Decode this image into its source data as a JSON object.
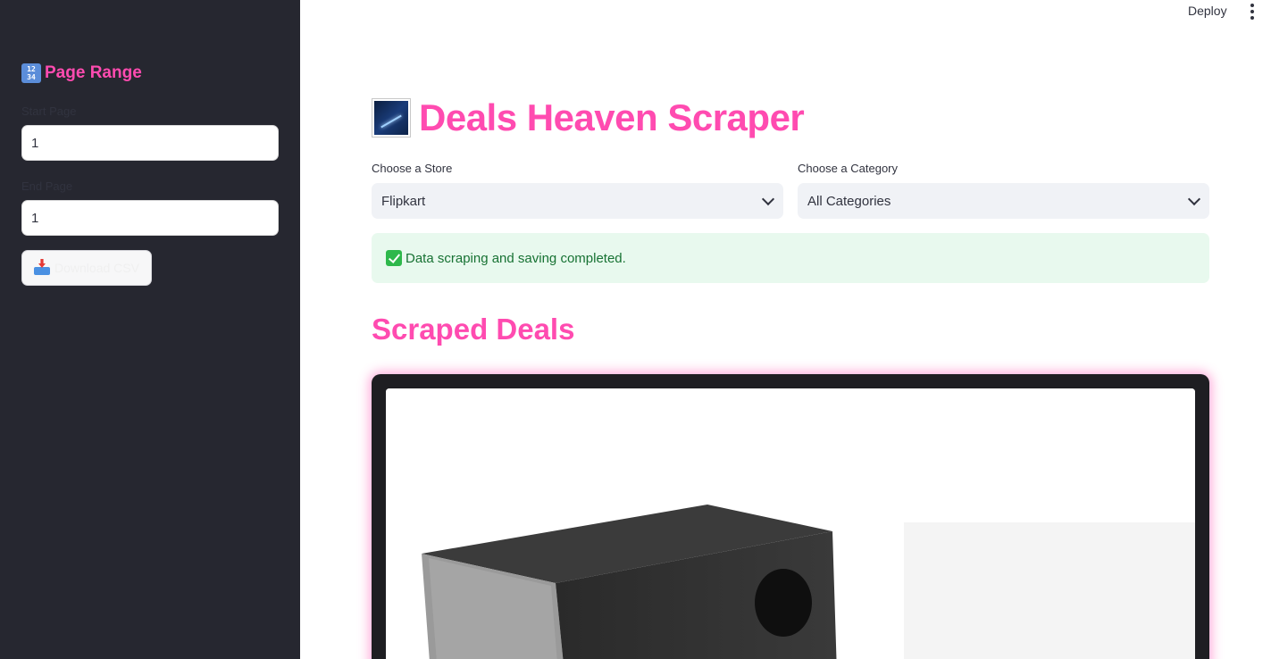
{
  "sidebar": {
    "title": "Page Range",
    "title_icon": "input-numbers-icon",
    "start_label": "Start Page",
    "start_value": "1",
    "end_label": "End Page",
    "end_value": "1",
    "download_label": "Download CSV",
    "download_icon": "inbox-tray-icon"
  },
  "topbar": {
    "deploy_label": "Deploy",
    "menu_icon": "kebab-menu-icon"
  },
  "main": {
    "title": "Deals Heaven Scraper",
    "title_icon": "milky-way-icon",
    "store_label": "Choose a Store",
    "store_value": "Flipkart",
    "category_label": "Choose a Category",
    "category_value": "All Categories",
    "status_message": "Data scraping and saving completed.",
    "status_icon": "check-mark-button-icon",
    "section_title": "Scraped Deals"
  },
  "colors": {
    "accent": "#ff4bb0",
    "sidebar_bg": "#262730",
    "success_bg": "#e8f9ee",
    "success_text": "#177233"
  }
}
